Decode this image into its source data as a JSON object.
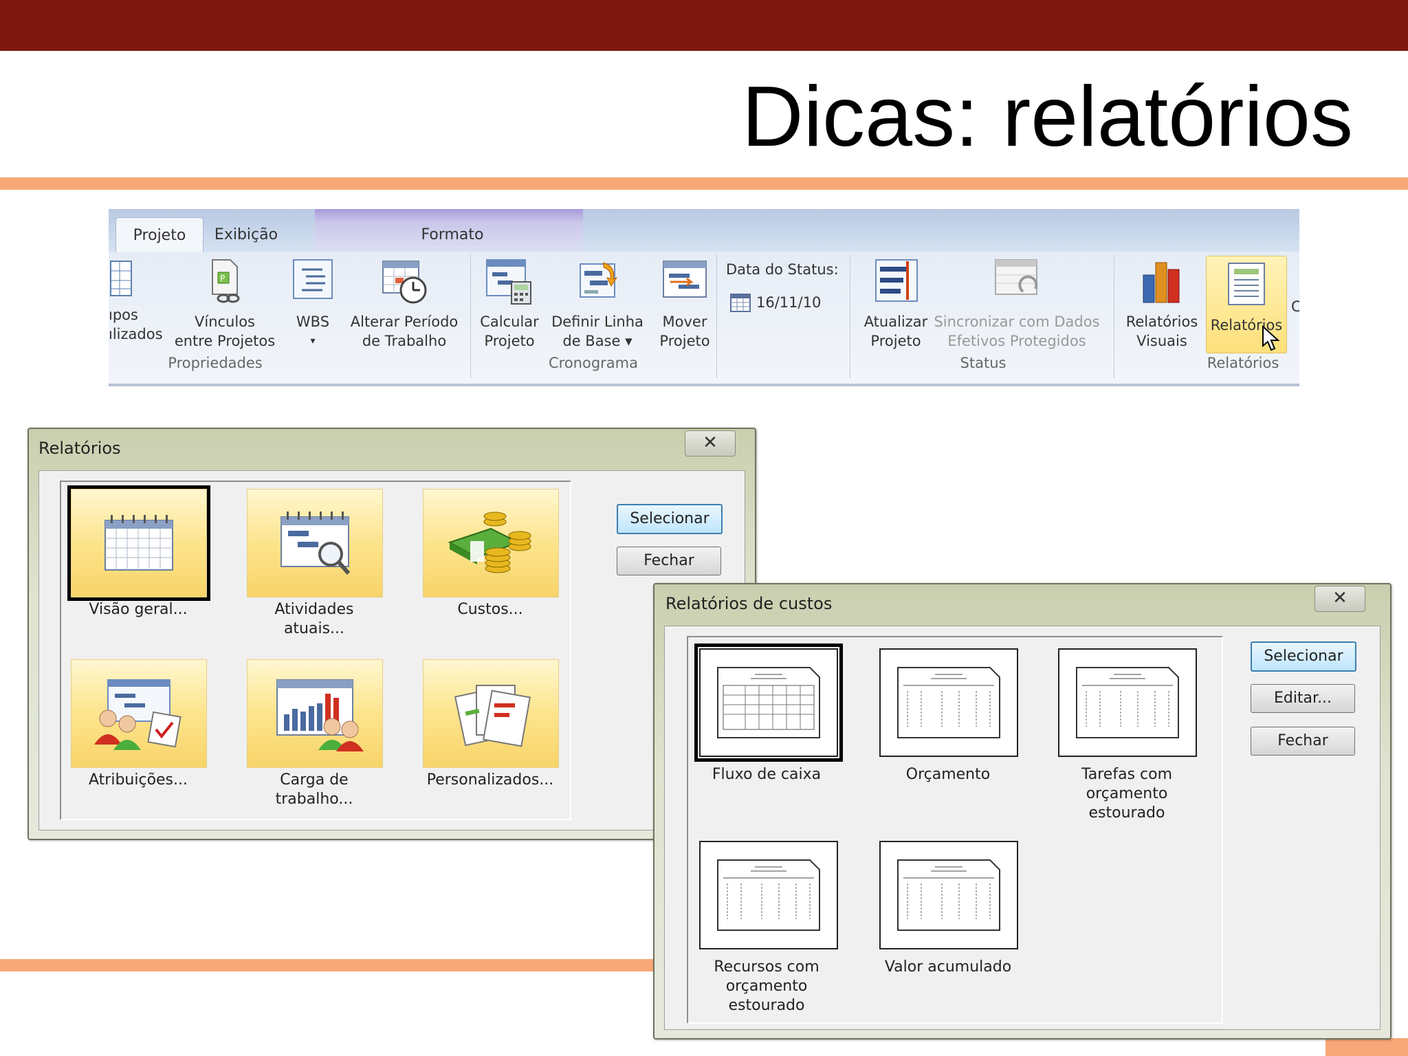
{
  "slide": {
    "title": "Dicas: relatórios"
  },
  "ribbon": {
    "tabs": [
      "Projeto",
      "Exibição",
      "Formato"
    ],
    "buttons": {
      "campos": [
        "ıpos",
        "ılizados"
      ],
      "vinculos": [
        "Vínculos",
        "entre Projetos"
      ],
      "wbs": [
        "WBS",
        "▾"
      ],
      "alterar": [
        "Alterar Período",
        "de Trabalho"
      ],
      "calcular": [
        "Calcular",
        "Projeto"
      ],
      "definir": [
        "Definir Linha",
        "de Base ▾"
      ],
      "mover": [
        "Mover",
        "Projeto"
      ],
      "atualizar": [
        "Atualizar",
        "Projeto"
      ],
      "sincronizar": [
        "Sincronizar com Dados",
        "Efetivos Protegidos"
      ],
      "relatorios_visuais": [
        "Relatórios",
        "Visuais"
      ],
      "relatorios": [
        "Relatórios",
        ""
      ]
    },
    "status_label": "Data do Status:",
    "status_date": "16/11/10",
    "groups": {
      "propriedades": "Propriedades",
      "cronograma": "Cronograma",
      "status": "Status",
      "relatorios": "Relatórios"
    },
    "overflow_char": "C"
  },
  "dialog_reports": {
    "title": "Relatórios",
    "close": "✕",
    "tiles": [
      [
        "Visão geral...",
        ""
      ],
      [
        "Atividades",
        "atuais..."
      ],
      [
        "Custos...",
        ""
      ],
      [
        "Atribuições...",
        ""
      ],
      [
        "Carga de",
        "trabalho..."
      ],
      [
        "Personalizados...",
        ""
      ]
    ],
    "buttons": {
      "select": "Selecionar",
      "close": "Fechar"
    }
  },
  "dialog_costs": {
    "title": "Relatórios de custos",
    "close": "✕",
    "tiles": [
      [
        "Fluxo de caixa",
        "",
        ""
      ],
      [
        "Orçamento",
        "",
        ""
      ],
      [
        "Tarefas com",
        "orçamento",
        "estourado"
      ],
      [
        "Recursos com",
        "orçamento",
        "estourado"
      ],
      [
        "Valor acumulado",
        "",
        ""
      ]
    ],
    "buttons": {
      "select": "Selecionar",
      "edit": "Editar...",
      "close": "Fechar"
    }
  },
  "colors": {
    "top_bar": "#7e180e",
    "accent_orange": "#f8a878",
    "tile_gold": "#fde48c",
    "ribbon_blue": "#dde7f3"
  }
}
